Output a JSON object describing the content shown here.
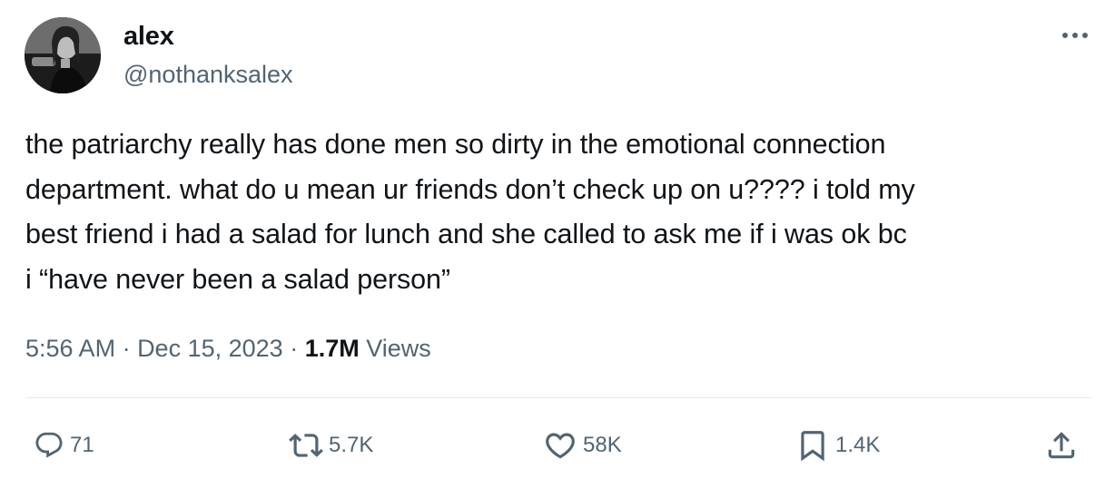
{
  "author": {
    "display_name": "alex",
    "handle": "@nothanksalex"
  },
  "tweet": {
    "text": "the patriarchy really has done men so dirty in the emotional connection\ndepartment. what do u mean ur friends don’t check up on u???? i told my\nbest friend i had a salad for lunch and she called to ask me if i was ok bc\ni “have never been a salad person”"
  },
  "meta": {
    "time": "5:56 AM",
    "separator": " · ",
    "date": "Dec 15, 2023",
    "views_count": "1.7M",
    "views_label": " Views"
  },
  "actions": {
    "replies": "71",
    "retweets": "5.7K",
    "likes": "58K",
    "bookmarks": "1.4K"
  },
  "icons": {
    "more": "more-horizontal-icon",
    "reply": "reply-icon",
    "retweet": "retweet-icon",
    "like": "heart-icon",
    "bookmark": "bookmark-icon",
    "share": "share-icon"
  },
  "colors": {
    "text": "#0f1419",
    "secondary": "#536471",
    "divider": "#e6e9eb"
  }
}
